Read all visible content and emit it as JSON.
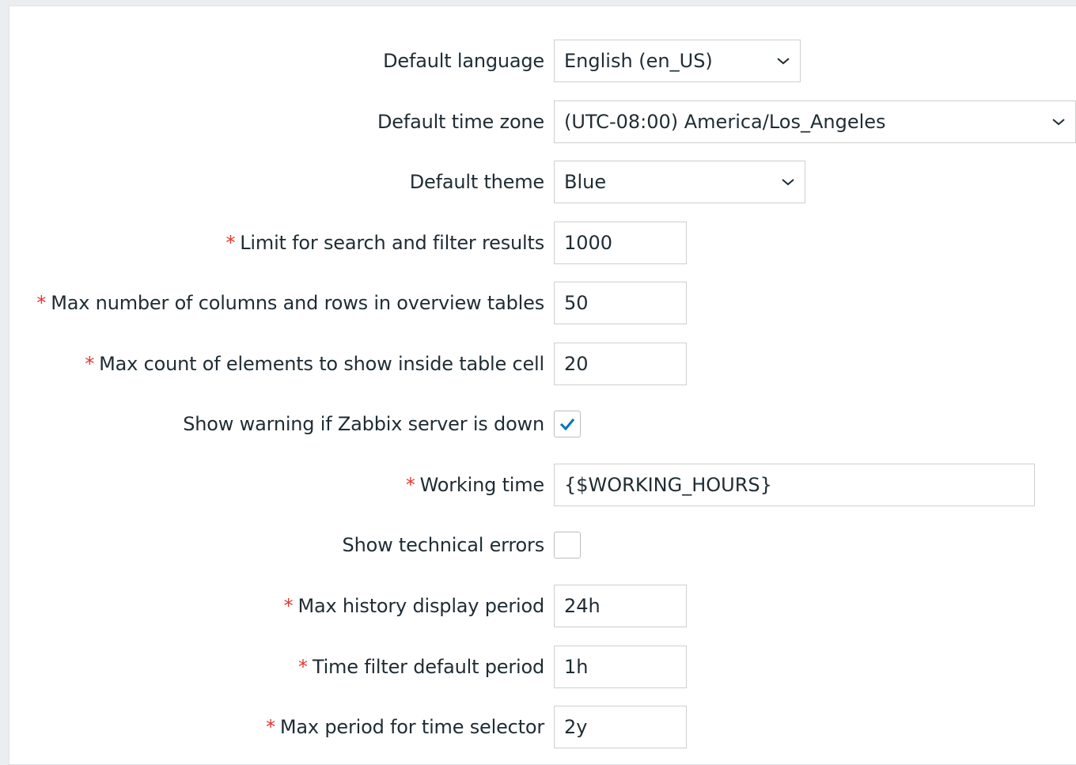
{
  "fields": {
    "language": {
      "label": "Default language",
      "value": "English (en_US)"
    },
    "timezone": {
      "label": "Default time zone",
      "value": "(UTC-08:00) America/Los_Angeles"
    },
    "theme": {
      "label": "Default theme",
      "value": "Blue"
    },
    "search_limit": {
      "required": "*",
      "label": "Limit for search and filter results",
      "value": "1000"
    },
    "max_overview": {
      "required": "*",
      "label": "Max number of columns and rows in overview tables",
      "value": "50"
    },
    "max_in_table": {
      "required": "*",
      "label": "Max count of elements to show inside table cell",
      "value": "20"
    },
    "server_check": {
      "label": "Show warning if Zabbix server is down",
      "checked": true
    },
    "work_period": {
      "required": "*",
      "label": "Working time",
      "value": "{$WORKING_HOURS}"
    },
    "show_tech_errors": {
      "label": "Show technical errors",
      "checked": false
    },
    "history_period": {
      "required": "*",
      "label": "Max history display period",
      "value": "24h"
    },
    "period_default": {
      "required": "*",
      "label": "Time filter default period",
      "value": "1h"
    },
    "max_period": {
      "required": "*",
      "label": "Max period for time selector",
      "value": "2y"
    }
  },
  "icons": {
    "dropdown": "chevron-down-icon",
    "checked": "checkmark-icon"
  },
  "colors": {
    "required": "#e33734",
    "checkmark": "#0275b8",
    "text": "#1f2c33"
  }
}
